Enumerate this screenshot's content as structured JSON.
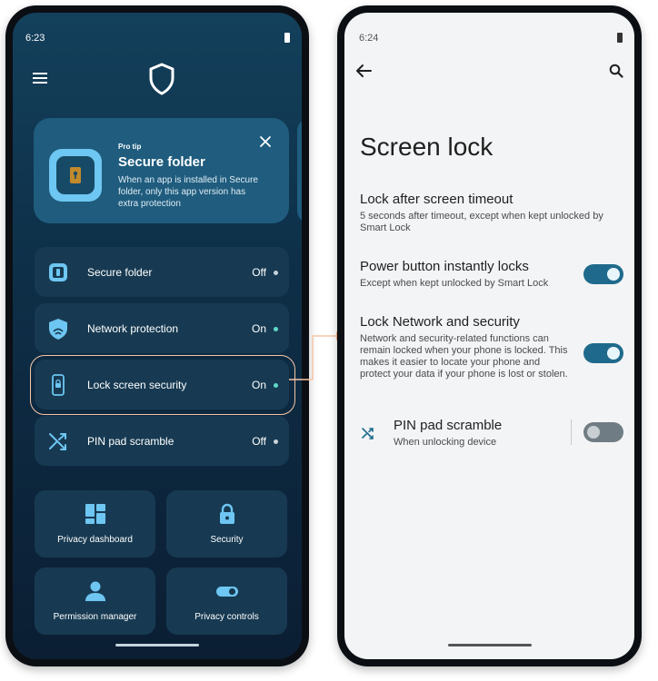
{
  "left_screen": {
    "status_time": "6:23",
    "tip": {
      "label": "Pro tip",
      "title": "Secure folder",
      "description": "When an app is installed in Secure folder, only this app version has extra protection"
    },
    "features": [
      {
        "label": "Secure folder",
        "state": "Off",
        "dot_color": "#c9d3da"
      },
      {
        "label": "Network protection",
        "state": "On",
        "dot_color": "#5fd8c8"
      },
      {
        "label": "Lock screen security",
        "state": "On",
        "dot_color": "#5fd8c8"
      },
      {
        "label": "PIN pad scramble",
        "state": "Off",
        "dot_color": "#c9d3da"
      }
    ],
    "tiles": [
      {
        "label": "Privacy dashboard",
        "icon": "dashboard-icon"
      },
      {
        "label": "Security",
        "icon": "lock-icon"
      },
      {
        "label": "Permission manager",
        "icon": "person-icon"
      },
      {
        "label": "Privacy controls",
        "icon": "toggle-icon"
      }
    ],
    "colors": {
      "highlight": "#f7c6a6",
      "accent_on": "#5fd8c8"
    }
  },
  "right_screen": {
    "status_time": "6:24",
    "title": "Screen lock",
    "settings": [
      {
        "title": "Lock after screen timeout",
        "description": "5 seconds after timeout, except when kept unlocked by Smart Lock"
      },
      {
        "title": "Power button instantly locks",
        "description": "Except when kept unlocked by Smart Lock",
        "toggle": "on"
      },
      {
        "title": "Lock Network and security",
        "description": "Network and security-related functions can remain locked when your phone is locked. This makes it easier to locate your phone and protect your data if your phone is lost or stolen.",
        "toggle": "on"
      },
      {
        "title": "PIN pad scramble",
        "description": "When unlocking device",
        "toggle": "off"
      }
    ],
    "colors": {
      "toggle_on": "#1f6a8c",
      "toggle_off": "#707c84"
    }
  }
}
